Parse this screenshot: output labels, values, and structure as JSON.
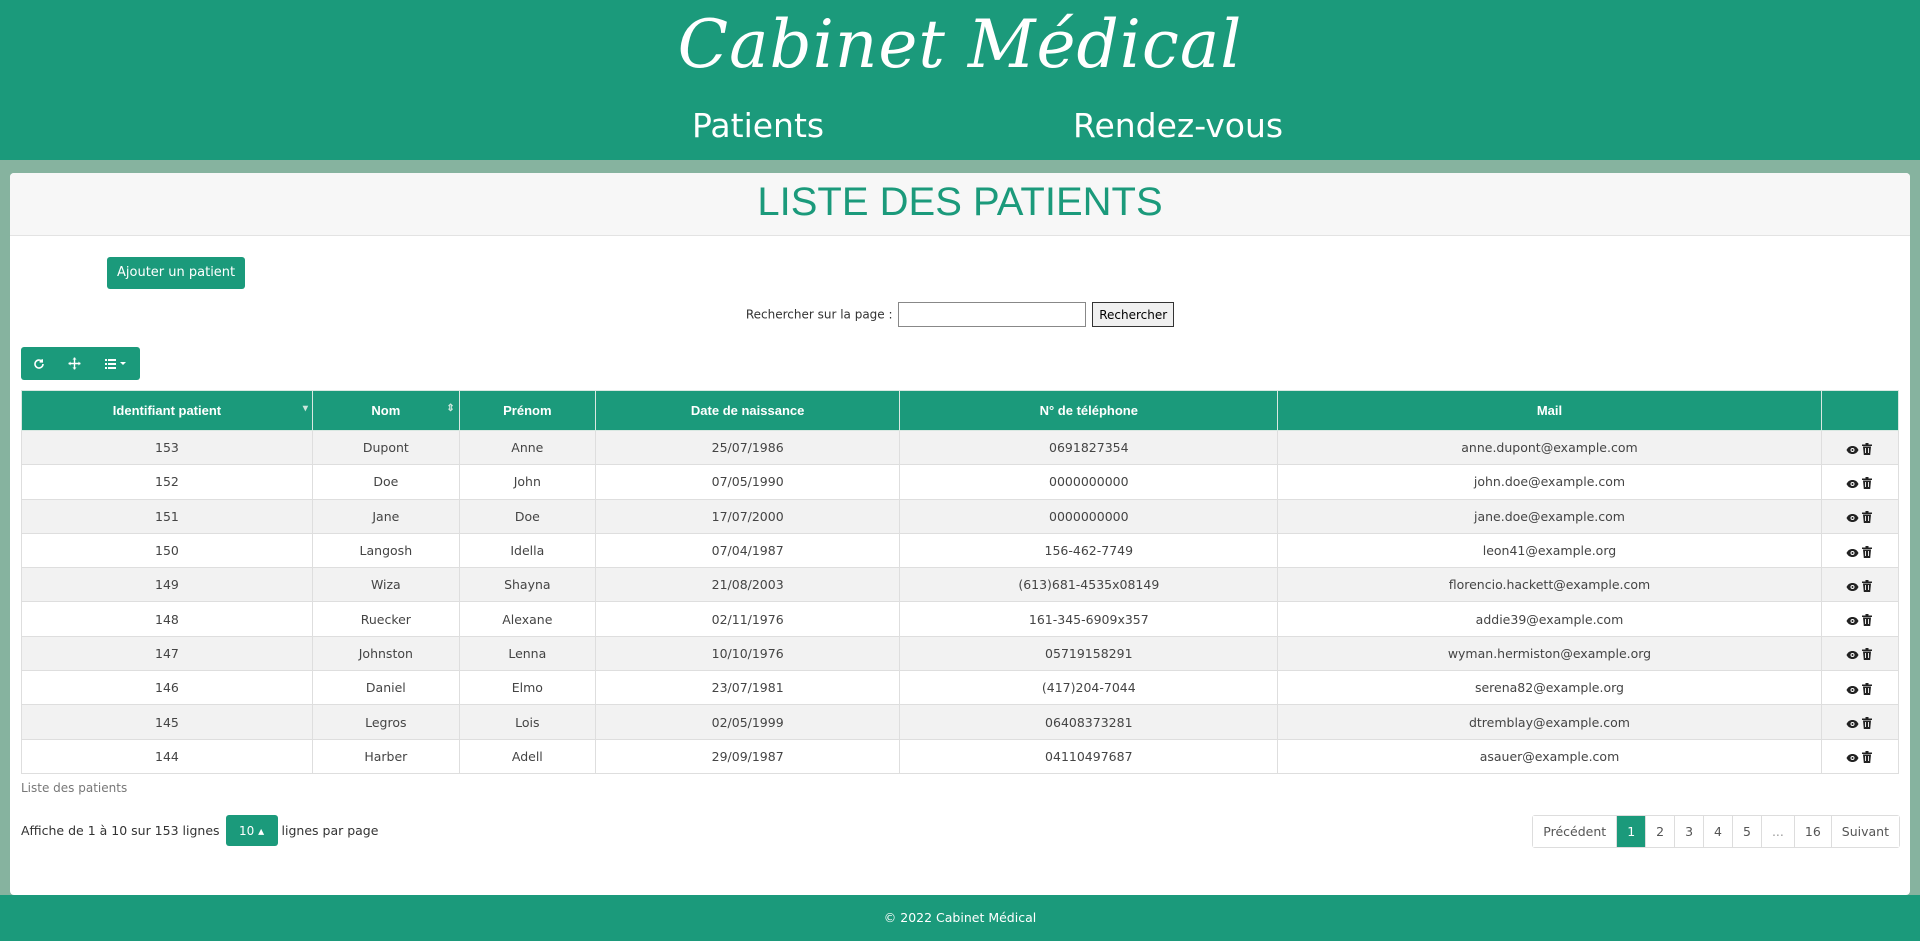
{
  "header": {
    "brand": "Cabinet Médical",
    "nav": {
      "patients": "Patients",
      "rdv": "Rendez-vous"
    }
  },
  "main": {
    "title": "LISTE DES PATIENTS",
    "add_button": "Ajouter un patient",
    "search": {
      "label": "Rechercher sur la page :",
      "value": "",
      "button": "Rechercher"
    },
    "toolbar": {
      "refresh_icon": "refresh-icon",
      "move_icon": "move-icon",
      "columns_icon": "list-icon"
    },
    "columns": [
      "Identifiant patient",
      "Nom",
      "Prénom",
      "Date de naissance",
      "N° de téléphone",
      "Mail",
      ""
    ],
    "rows": [
      [
        "153",
        "Dupont",
        "Anne",
        "25/07/1986",
        "0691827354",
        "anne.dupont@example.com"
      ],
      [
        "152",
        "Doe",
        "John",
        "07/05/1990",
        "0000000000",
        "john.doe@example.com"
      ],
      [
        "151",
        "Jane",
        "Doe",
        "17/07/2000",
        "0000000000",
        "jane.doe@example.com"
      ],
      [
        "150",
        "Langosh",
        "Idella",
        "07/04/1987",
        "156-462-7749",
        "leon41@example.org"
      ],
      [
        "149",
        "Wiza",
        "Shayna",
        "21/08/2003",
        "(613)681-4535x08149",
        "florencio.hackett@example.com"
      ],
      [
        "148",
        "Ruecker",
        "Alexane",
        "02/11/1976",
        "161-345-6909x357",
        "addie39@example.com"
      ],
      [
        "147",
        "Johnston",
        "Lenna",
        "10/10/1976",
        "05719158291",
        "wyman.hermiston@example.org"
      ],
      [
        "146",
        "Daniel",
        "Elmo",
        "23/07/1981",
        "(417)204-7044",
        "serena82@example.org"
      ],
      [
        "145",
        "Legros",
        "Lois",
        "02/05/1999",
        "06408373281",
        "dtremblay@example.com"
      ],
      [
        "144",
        "Harber",
        "Adell",
        "29/09/1987",
        "04110497687",
        "asauer@example.com"
      ]
    ],
    "caption": "Liste des patients",
    "pagination_info": {
      "prefix": "Affiche de 1 à 10 sur 153 lignes",
      "per_page": "10",
      "suffix": "lignes par page"
    },
    "pages": [
      "Précédent",
      "1",
      "2",
      "3",
      "4",
      "5",
      "...",
      "16",
      "Suivant"
    ],
    "active_page": "1"
  },
  "footer": {
    "text": "© 2022 Cabinet Médical"
  },
  "colors": {
    "primary": "#1b9a7b",
    "background": "#86b39f"
  }
}
